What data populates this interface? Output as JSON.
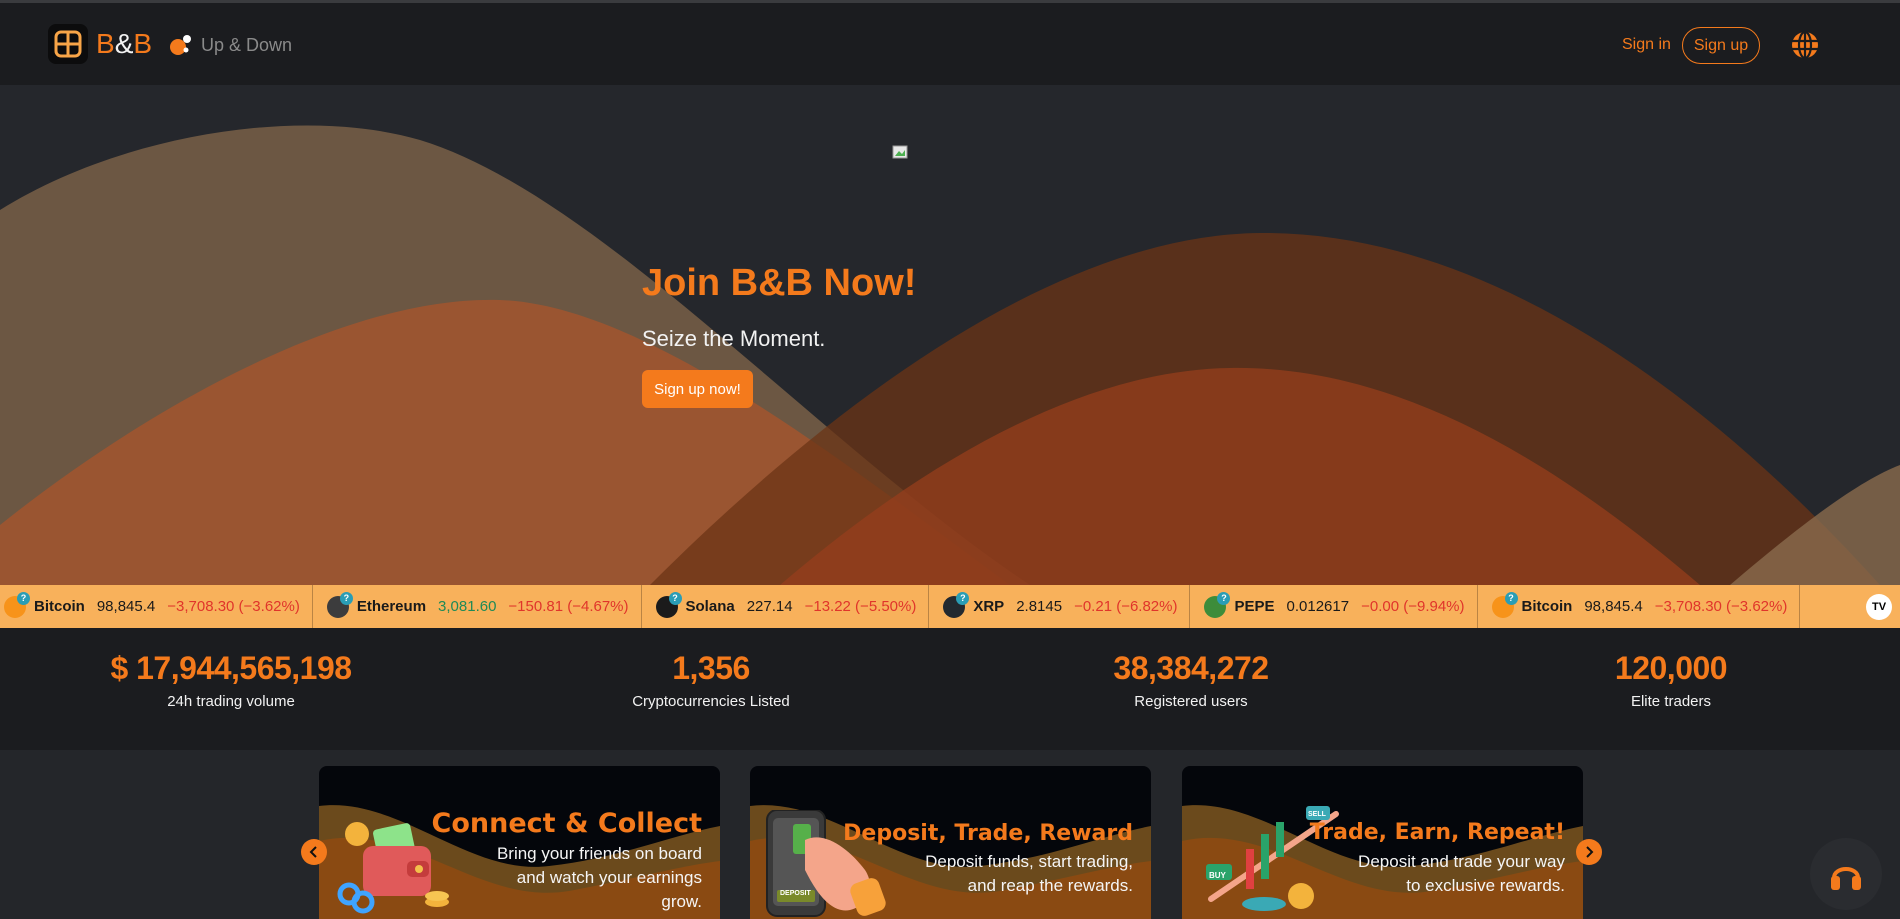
{
  "header": {
    "logo_left": "B",
    "logo_amp": "&",
    "logo_right": "B",
    "updown_label": "Up & Down",
    "signin_label": "Sign in",
    "signup_label": "Sign up",
    "globe_icon": "globe-icon"
  },
  "hero": {
    "title": "Join B&B Now!",
    "subtitle": "Seize the Moment.",
    "cta_label": "Sign up now!"
  },
  "ticker": {
    "items": [
      {
        "name": "Bitcoin",
        "price": "98,845.4",
        "change": "−3,708.30 (−3.62%)",
        "icon_color": "#f7931a"
      },
      {
        "name": "Ethereum",
        "price": "3,081.60",
        "change": "−150.81 (−4.67%)",
        "icon_color": "#3c3c3d"
      },
      {
        "name": "Solana",
        "price": "227.14",
        "change": "−13.22 (−5.50%)",
        "icon_color": "#1b1b1b"
      },
      {
        "name": "XRP",
        "price": "2.8145",
        "change": "−0.21 (−6.82%)",
        "icon_color": "#23292f"
      },
      {
        "name": "PEPE",
        "price": "0.012617",
        "change": "−0.00 (−9.94%)",
        "icon_color": "#3d8c3a"
      },
      {
        "name": "Bitcoin",
        "price": "98,845.4",
        "change": "−3,708.30 (−3.62%)",
        "icon_color": "#f7931a"
      }
    ],
    "badge": "TV"
  },
  "stats": [
    {
      "value": "$ 17,944,565,198",
      "label": "24h trading volume"
    },
    {
      "value": "1,356",
      "label": "Cryptocurrencies Listed"
    },
    {
      "value": "38,384,272",
      "label": "Registered users"
    },
    {
      "value": "120,000",
      "label": "Elite traders"
    }
  ],
  "promos": [
    {
      "title": "Connect & Collect",
      "desc1": "Bring your friends on board",
      "desc2": "and watch your earnings",
      "desc3": "grow."
    },
    {
      "title": "Deposit, Trade, Reward",
      "desc1": "Deposit funds, start trading,",
      "desc2": "and reap the rewards.",
      "deposit_tag": "DEPOSIT"
    },
    {
      "title": "Trade, Earn, Repeat!",
      "desc1": "Deposit and trade your way",
      "desc2": "to exclusive rewards.",
      "buy_tag": "BUY",
      "sell_tag": "SELL"
    }
  ],
  "colors": {
    "accent": "#f47a1c",
    "ticker_bg": "#f8b15b",
    "negative": "#e0352b",
    "positive": "#1e8a57"
  }
}
